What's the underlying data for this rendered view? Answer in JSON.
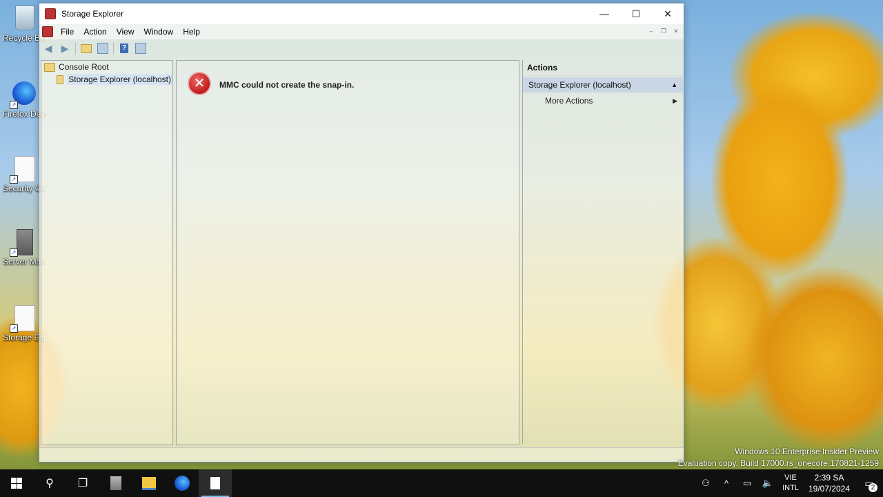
{
  "desktop": {
    "icons": [
      {
        "label": "Recycle Bin"
      },
      {
        "label": "Firefox Developer Edition"
      },
      {
        "label": "Security Configuration"
      },
      {
        "label": "Server Manager"
      },
      {
        "label": "Storage Explorer"
      }
    ]
  },
  "window": {
    "title": "Storage Explorer",
    "controls": {
      "minimize": "—",
      "maximize": "☐",
      "close": "✕"
    }
  },
  "menubar": {
    "items": [
      "File",
      "Action",
      "View",
      "Window",
      "Help"
    ],
    "mdi": {
      "minimize": "–",
      "restore": "❐",
      "close": "✕"
    }
  },
  "tree": {
    "root": "Console Root",
    "child": "Storage Explorer (localhost)"
  },
  "center": {
    "error_message": "MMC could not create the snap-in."
  },
  "actions": {
    "header": "Actions",
    "section": "Storage Explorer (localhost)",
    "items": [
      "More Actions"
    ]
  },
  "watermark": {
    "line1": "Windows 10 Enterprise Insider Preview",
    "line2": "Evaluation copy. Build 17000.rs_onecore.170821-1259"
  },
  "taskbar": {
    "lang_line1": "VIE",
    "lang_line2": "INTL",
    "time": "2:39 SA",
    "date": "19/07/2024",
    "notification_count": "2"
  },
  "colors": {
    "accent": "#7ab4e8",
    "error": "#c11b1b",
    "taskbar": "#101010"
  }
}
